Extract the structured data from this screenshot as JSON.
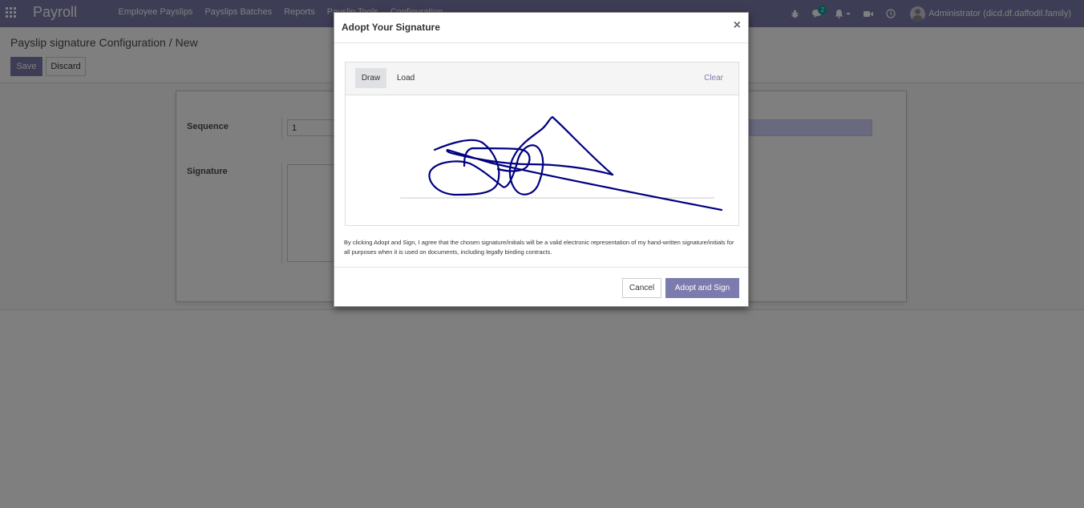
{
  "navbar": {
    "brand": "Payroll",
    "menu": [
      "Employee Payslips",
      "Payslips Batches",
      "Reports",
      "Payslip Tools",
      "Configuration"
    ],
    "icons": [
      "bug-icon",
      "chat-icon",
      "bell-icon",
      "video-icon",
      "clock-icon"
    ],
    "chat_count": "2",
    "user": "Administrator (dicd.df.daffodil.family)"
  },
  "breadcrumb": {
    "parent": "Payslip signature Configuration",
    "separator": "/",
    "current": "New"
  },
  "buttons": {
    "save": "Save",
    "discard": "Discard"
  },
  "form": {
    "sequence_label": "Sequence",
    "sequence_value": "1",
    "signature_label": "Signature"
  },
  "modal": {
    "title": "Adopt Your Signature",
    "close": "×",
    "mode_draw": "Draw",
    "mode_load": "Load",
    "clear": "Clear",
    "legal": "By clicking Adopt and Sign, I agree that the chosen signature/initials will be a valid electronic representation of my hand-written signature/initials for all purposes when it is used on documents, including legally binding contracts.",
    "cancel": "Cancel",
    "adopt": "Adopt and Sign"
  },
  "colors": {
    "brand": "#7c7bad",
    "ink": "#000080",
    "badge": "#00a09d"
  }
}
